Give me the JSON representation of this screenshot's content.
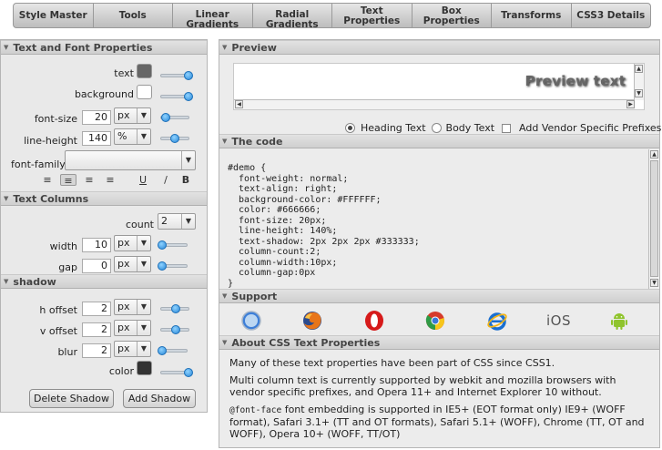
{
  "tabs": [
    {
      "label": "Style Master"
    },
    {
      "label": "Tools"
    },
    {
      "label": "Linear Gradients"
    },
    {
      "label": "Radial Gradients"
    },
    {
      "label": "Text Properties"
    },
    {
      "label": "Box Properties"
    },
    {
      "label": "Transforms"
    },
    {
      "label": "CSS3 Details"
    }
  ],
  "left": {
    "text_font": {
      "title": "Text and Font Properties",
      "text_label": "text",
      "text_color": "#666666",
      "background_label": "background",
      "background_color": "#FFFFFF",
      "font_size_label": "font-size",
      "font_size_value": "20",
      "font_size_unit": "px",
      "line_height_label": "line-height",
      "line_height_value": "140",
      "line_height_unit": "%",
      "font_family_label": "font-family",
      "font_family_value": "",
      "underline": "U",
      "italic": "/",
      "bold": "B"
    },
    "columns": {
      "title": "Text Columns",
      "count_label": "count",
      "count_value": "2",
      "width_label": "width",
      "width_value": "10",
      "width_unit": "px",
      "gap_label": "gap",
      "gap_value": "0",
      "gap_unit": "px"
    },
    "shadow": {
      "title": "shadow",
      "h_offset_label": "h offset",
      "h_offset_value": "2",
      "h_offset_unit": "px",
      "v_offset_label": "v offset",
      "v_offset_value": "2",
      "v_offset_unit": "px",
      "blur_label": "blur",
      "blur_value": "2",
      "blur_unit": "px",
      "color_label": "color",
      "color_value": "#333333",
      "delete_label": "Delete Shadow",
      "add_label": "Add Shadow"
    }
  },
  "preview": {
    "title": "Preview",
    "text": "Preview text",
    "heading_label": "Heading Text",
    "body_label": "Body Text",
    "vendor_label": "Add Vendor Specific Prefixes"
  },
  "code": {
    "title": "The code",
    "content": "#demo {\n  font-weight: normal;\n  text-align: right;\n  background-color: #FFFFFF;\n  color: #666666;\n  font-size: 20px;\n  line-height: 140%;\n  text-shadow: 2px 2px 2px #333333;\n  column-count:2;\n  column-width:10px;\n  column-gap:0px\n}"
  },
  "support": {
    "title": "Support",
    "browsers": [
      "safari-icon",
      "firefox-icon",
      "opera-icon",
      "chrome-icon",
      "ie-icon",
      "ios-icon",
      "android-icon"
    ],
    "ios_label": "iOS"
  },
  "about": {
    "title": "About CSS Text Properties",
    "p1": "Many of these text properties have been part of CSS since CSS1.",
    "p2": "Multi column text is currently supported by webkit and mozilla browsers with vendor specific prefixes, and Opera 11+ and Internet Explorer 10 without.",
    "p3_code": "@font-face",
    "p3_text": " font embedding is supported in IE5+ (EOT format only) IE9+ (WOFF format), Safari 3.1+ (TT and OT formats), Safari 5.1+ (WOFF), Chrome (TT, OT and WOFF), Opera 10+ (WOFF, TT/OT)"
  }
}
